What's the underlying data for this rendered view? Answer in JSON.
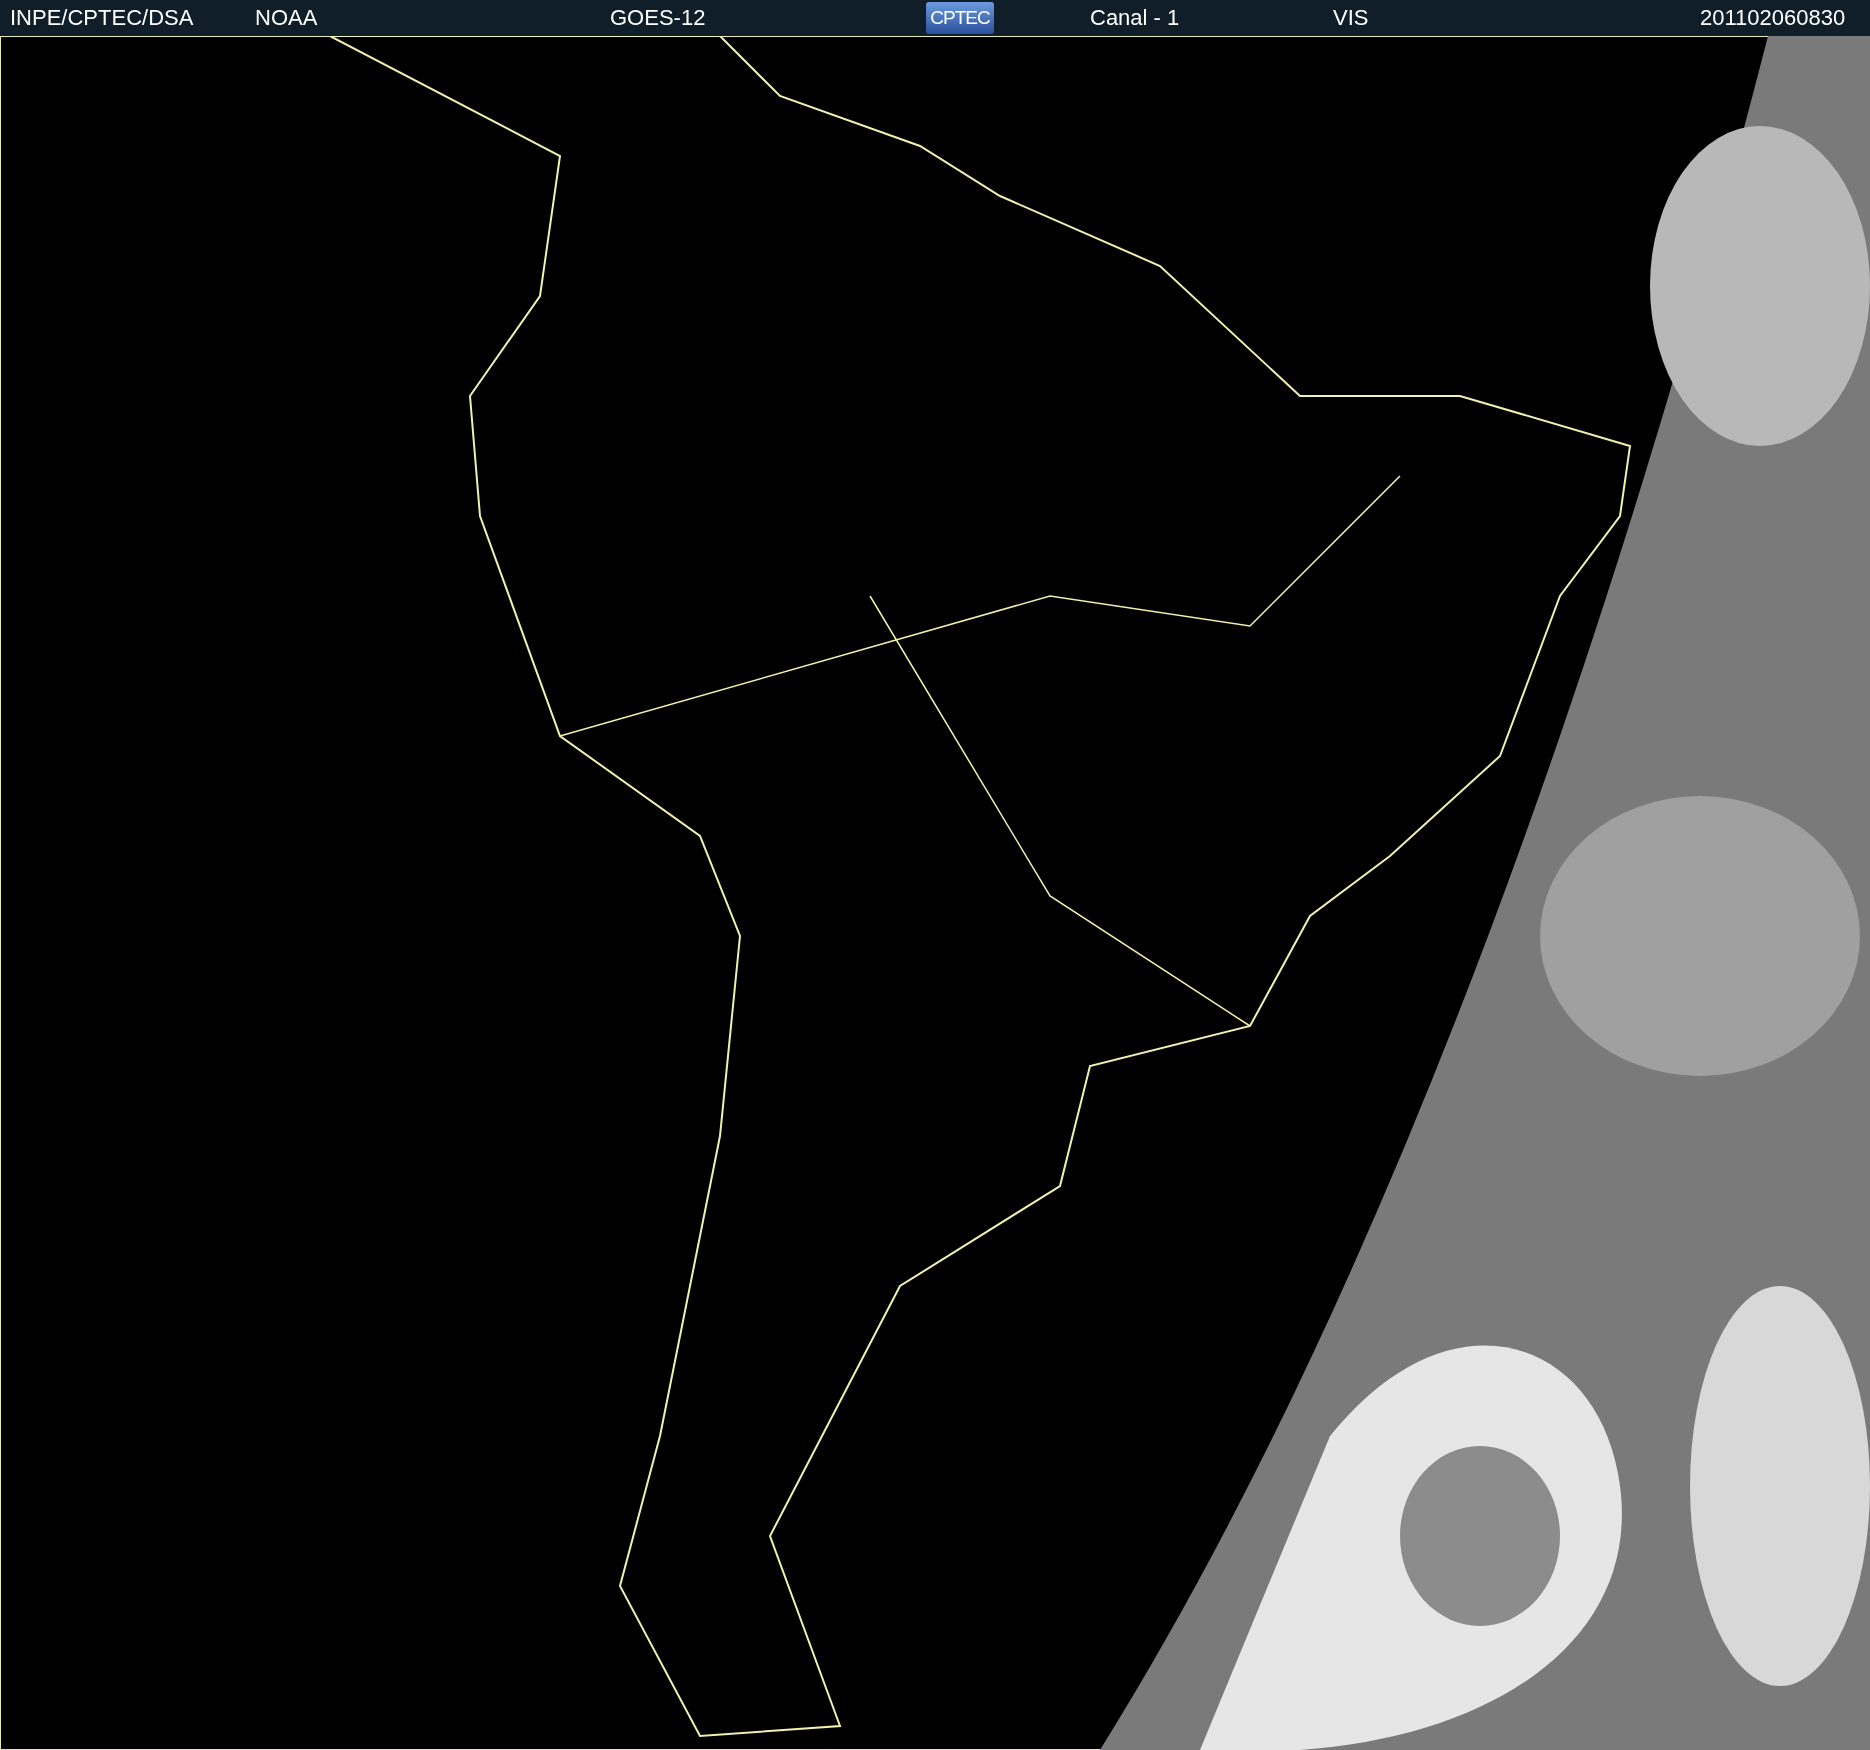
{
  "header": {
    "items": [
      {
        "kind": "text",
        "text": "INPE/CPTEC/DSA"
      },
      {
        "kind": "text",
        "text": "NOAA"
      },
      {
        "kind": "text",
        "text": "GOES-12"
      },
      {
        "kind": "logo",
        "text": "CPTEC"
      },
      {
        "kind": "text",
        "text": "Canal - 1"
      },
      {
        "kind": "text",
        "text": "VIS"
      },
      {
        "kind": "text",
        "text": "201102060830"
      }
    ]
  }
}
